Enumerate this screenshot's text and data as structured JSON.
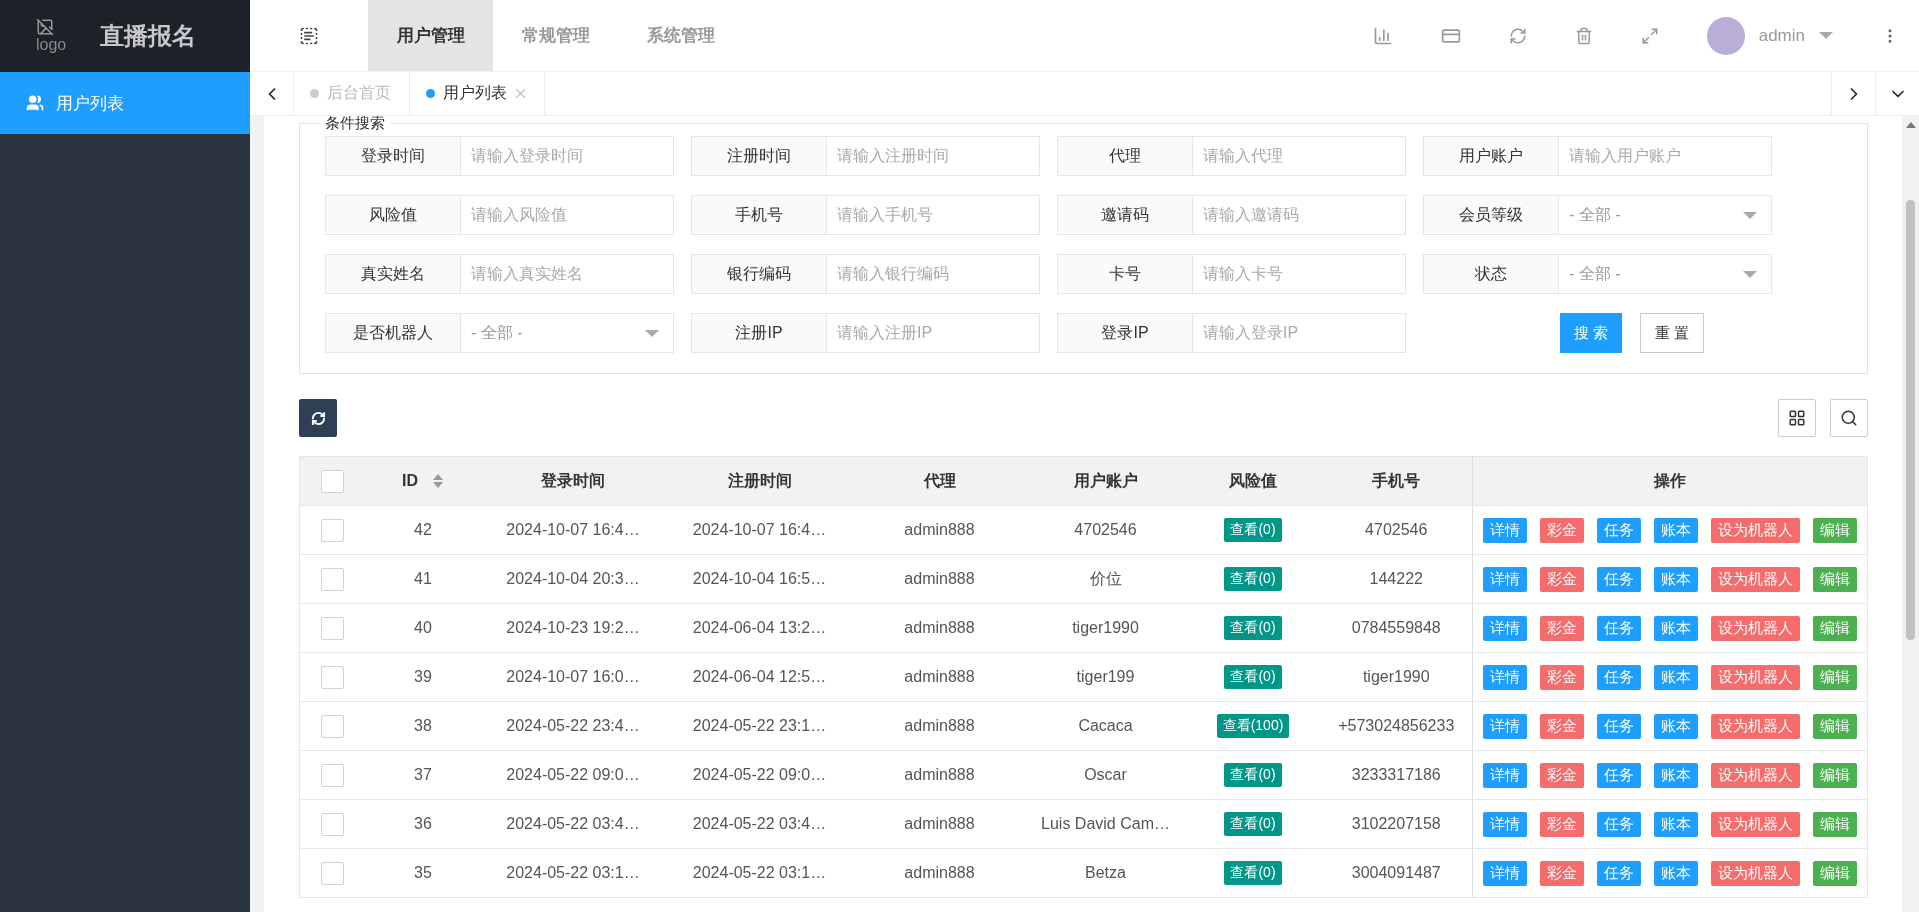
{
  "logo": {
    "alt": "logo",
    "title": "直播报名"
  },
  "top_nav": [
    {
      "label": "用户管理",
      "selected": true
    },
    {
      "label": "常规管理",
      "selected": false
    },
    {
      "label": "系统管理",
      "selected": false
    }
  ],
  "user": {
    "name": "admin"
  },
  "sidebar": {
    "items": [
      {
        "label": "用户列表",
        "selected": true
      }
    ]
  },
  "tabs": [
    {
      "label": "后台首页",
      "selected": false,
      "closable": false
    },
    {
      "label": "用户列表",
      "selected": true,
      "closable": true
    }
  ],
  "search": {
    "legend": "条件搜索",
    "filters": [
      {
        "label": "登录时间",
        "kind": "input",
        "placeholder": "请输入登录时间"
      },
      {
        "label": "注册时间",
        "kind": "input",
        "placeholder": "请输入注册时间"
      },
      {
        "label": "代理",
        "kind": "input",
        "placeholder": "请输入代理"
      },
      {
        "label": "用户账户",
        "kind": "input",
        "placeholder": "请输入用户账户"
      },
      {
        "label": "风险值",
        "kind": "input",
        "placeholder": "请输入风险值"
      },
      {
        "label": "手机号",
        "kind": "input",
        "placeholder": "请输入手机号"
      },
      {
        "label": "邀请码",
        "kind": "input",
        "placeholder": "请输入邀请码"
      },
      {
        "label": "会员等级",
        "kind": "select",
        "value": "- 全部 -"
      },
      {
        "label": "真实姓名",
        "kind": "input",
        "placeholder": "请输入真实姓名"
      },
      {
        "label": "银行编码",
        "kind": "input",
        "placeholder": "请输入银行编码"
      },
      {
        "label": "卡号",
        "kind": "input",
        "placeholder": "请输入卡号"
      },
      {
        "label": "状态",
        "kind": "select",
        "value": "- 全部 -"
      },
      {
        "label": "是否机器人",
        "kind": "select",
        "value": "- 全部 -"
      },
      {
        "label": "注册IP",
        "kind": "input",
        "placeholder": "请输入注册IP"
      },
      {
        "label": "登录IP",
        "kind": "input",
        "placeholder": "请输入登录IP"
      }
    ],
    "buttons": [
      {
        "label": "搜 索",
        "kind": "primary"
      },
      {
        "label": "重 置",
        "kind": "plain"
      }
    ]
  },
  "table": {
    "header_checked": false,
    "columns": [
      {
        "label": "ID",
        "sortable": true
      },
      {
        "label": "登录时间",
        "sortable": false
      },
      {
        "label": "注册时间",
        "sortable": false
      },
      {
        "label": "代理",
        "sortable": false
      },
      {
        "label": "用户账户",
        "sortable": false
      },
      {
        "label": "风险值",
        "sortable": false
      },
      {
        "label": "手机号",
        "sortable": false
      },
      {
        "label": "操作",
        "sortable": false
      }
    ],
    "rows": [
      {
        "checked": false,
        "id": "42",
        "login_time": "2024-10-07 16:4…",
        "register_time": "2024-10-07 16:4…",
        "agent": "admin888",
        "account": "4702546",
        "risk": "查看(0)",
        "phone": "4702546",
        "actions": [
          {
            "label": "详情",
            "kind": "info"
          },
          {
            "label": "彩金",
            "kind": "danger"
          },
          {
            "label": "任务",
            "kind": "info"
          },
          {
            "label": "账本",
            "kind": "info"
          },
          {
            "label": "设为机器人",
            "kind": "danger"
          },
          {
            "label": "编辑",
            "kind": "success"
          }
        ]
      },
      {
        "checked": false,
        "id": "41",
        "login_time": "2024-10-04 20:3…",
        "register_time": "2024-10-04 16:5…",
        "agent": "admin888",
        "account": "价位",
        "risk": "查看(0)",
        "phone": "144222",
        "actions": [
          {
            "label": "详情",
            "kind": "info"
          },
          {
            "label": "彩金",
            "kind": "danger"
          },
          {
            "label": "任务",
            "kind": "info"
          },
          {
            "label": "账本",
            "kind": "info"
          },
          {
            "label": "设为机器人",
            "kind": "danger"
          },
          {
            "label": "编辑",
            "kind": "success"
          }
        ]
      },
      {
        "checked": false,
        "id": "40",
        "login_time": "2024-10-23 19:2…",
        "register_time": "2024-06-04 13:2…",
        "agent": "admin888",
        "account": "tiger1990",
        "risk": "查看(0)",
        "phone": "0784559848",
        "actions": [
          {
            "label": "详情",
            "kind": "info"
          },
          {
            "label": "彩金",
            "kind": "danger"
          },
          {
            "label": "任务",
            "kind": "info"
          },
          {
            "label": "账本",
            "kind": "info"
          },
          {
            "label": "设为机器人",
            "kind": "danger"
          },
          {
            "label": "编辑",
            "kind": "success"
          }
        ]
      },
      {
        "checked": false,
        "id": "39",
        "login_time": "2024-10-07 16:0…",
        "register_time": "2024-06-04 12:5…",
        "agent": "admin888",
        "account": "tiger199",
        "risk": "查看(0)",
        "phone": "tiger1990",
        "actions": [
          {
            "label": "详情",
            "kind": "info"
          },
          {
            "label": "彩金",
            "kind": "danger"
          },
          {
            "label": "任务",
            "kind": "info"
          },
          {
            "label": "账本",
            "kind": "info"
          },
          {
            "label": "设为机器人",
            "kind": "danger"
          },
          {
            "label": "编辑",
            "kind": "success"
          }
        ]
      },
      {
        "checked": false,
        "id": "38",
        "login_time": "2024-05-22 23:4…",
        "register_time": "2024-05-22 23:1…",
        "agent": "admin888",
        "account": "Cacaca",
        "risk": "查看(100)",
        "phone": "+573024856233",
        "actions": [
          {
            "label": "详情",
            "kind": "info"
          },
          {
            "label": "彩金",
            "kind": "danger"
          },
          {
            "label": "任务",
            "kind": "info"
          },
          {
            "label": "账本",
            "kind": "info"
          },
          {
            "label": "设为机器人",
            "kind": "danger"
          },
          {
            "label": "编辑",
            "kind": "success"
          }
        ]
      },
      {
        "checked": false,
        "id": "37",
        "login_time": "2024-05-22 09:0…",
        "register_time": "2024-05-22 09:0…",
        "agent": "admin888",
        "account": "Oscar",
        "risk": "查看(0)",
        "phone": "3233317186",
        "actions": [
          {
            "label": "详情",
            "kind": "info"
          },
          {
            "label": "彩金",
            "kind": "danger"
          },
          {
            "label": "任务",
            "kind": "info"
          },
          {
            "label": "账本",
            "kind": "info"
          },
          {
            "label": "设为机器人",
            "kind": "danger"
          },
          {
            "label": "编辑",
            "kind": "success"
          }
        ]
      },
      {
        "checked": false,
        "id": "36",
        "login_time": "2024-05-22 03:4…",
        "register_time": "2024-05-22 03:4…",
        "agent": "admin888",
        "account": "Luis David Cam…",
        "risk": "查看(0)",
        "phone": "3102207158",
        "actions": [
          {
            "label": "详情",
            "kind": "info"
          },
          {
            "label": "彩金",
            "kind": "danger"
          },
          {
            "label": "任务",
            "kind": "info"
          },
          {
            "label": "账本",
            "kind": "info"
          },
          {
            "label": "设为机器人",
            "kind": "danger"
          },
          {
            "label": "编辑",
            "kind": "success"
          }
        ]
      },
      {
        "checked": false,
        "id": "35",
        "login_time": "2024-05-22 03:1…",
        "register_time": "2024-05-22 03:1…",
        "agent": "admin888",
        "account": "Betza",
        "risk": "查看(0)",
        "phone": "3004091487",
        "actions": [
          {
            "label": "详情",
            "kind": "info"
          },
          {
            "label": "彩金",
            "kind": "danger"
          },
          {
            "label": "任务",
            "kind": "info"
          },
          {
            "label": "账本",
            "kind": "info"
          },
          {
            "label": "设为机器人",
            "kind": "danger"
          },
          {
            "label": "编辑",
            "kind": "success"
          }
        ]
      }
    ]
  }
}
